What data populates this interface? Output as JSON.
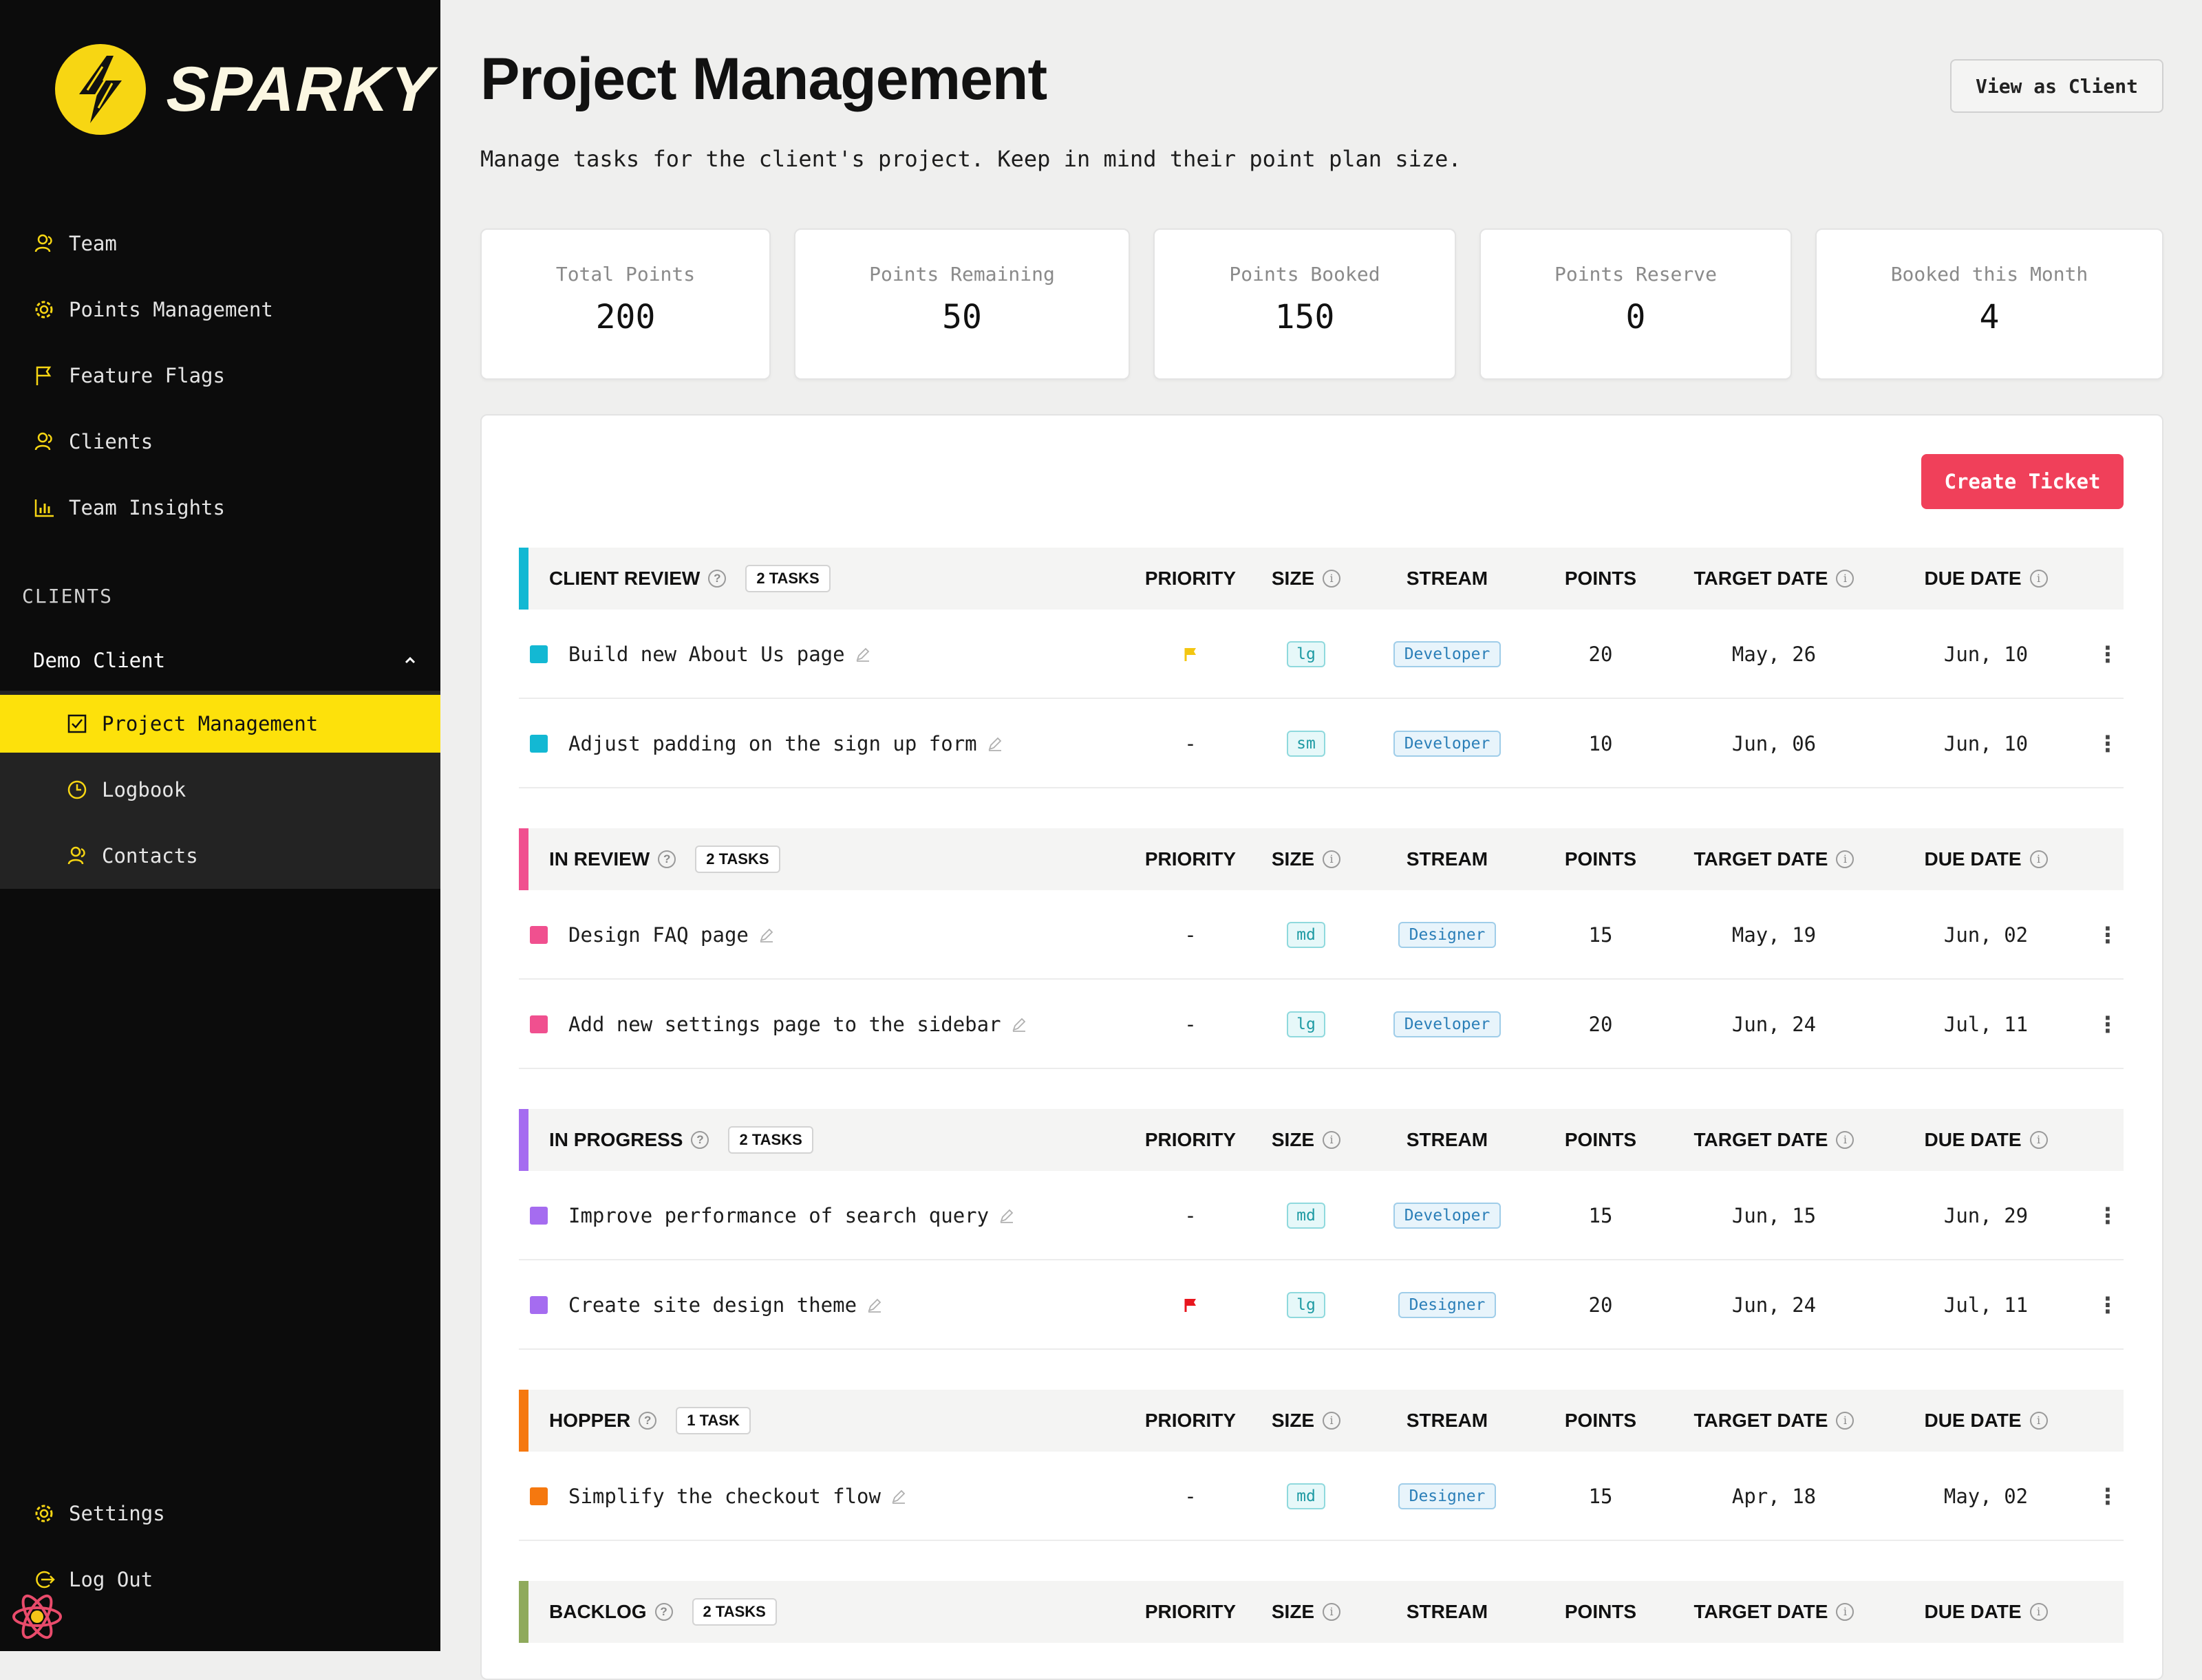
{
  "app": {
    "name": "SPARKY"
  },
  "sidebar": {
    "nav": [
      {
        "label": "Team",
        "icon": "users-icon"
      },
      {
        "label": "Points Management",
        "icon": "gear-icon"
      },
      {
        "label": "Feature Flags",
        "icon": "flag-icon"
      },
      {
        "label": "Clients",
        "icon": "users-icon"
      },
      {
        "label": "Team Insights",
        "icon": "bar-chart-icon"
      }
    ],
    "section_label": "CLIENTS",
    "client_name": "Demo Client",
    "client_subnav": [
      {
        "label": "Project Management",
        "icon": "checkbox-icon",
        "active": true
      },
      {
        "label": "Logbook",
        "icon": "clock-icon"
      },
      {
        "label": "Contacts",
        "icon": "users-icon"
      }
    ],
    "bottom": [
      {
        "label": "Settings",
        "icon": "gear-icon"
      },
      {
        "label": "Log Out",
        "icon": "logout-icon"
      }
    ]
  },
  "header": {
    "title": "Project Management",
    "subtitle": "Manage tasks for the client's project. Keep in mind their point plan size.",
    "view_as_client": "View as Client"
  },
  "stats": [
    {
      "label": "Total Points",
      "value": "200"
    },
    {
      "label": "Points Remaining",
      "value": "50"
    },
    {
      "label": "Points Booked",
      "value": "150"
    },
    {
      "label": "Points Reserve",
      "value": "0"
    },
    {
      "label": "Booked this Month",
      "value": "4"
    }
  ],
  "create_ticket": "Create Ticket",
  "columns": {
    "priority": "PRIORITY",
    "size": "SIZE",
    "stream": "STREAM",
    "points": "POINTS",
    "target": "TARGET DATE",
    "due": "DUE DATE"
  },
  "colors": {
    "accent": "#fde10b",
    "create": "#f0405a",
    "client_review": "#13b8d3",
    "in_review": "#f0508f",
    "in_progress": "#a56cf0",
    "hopper": "#f5780f",
    "backlog": "#8faa5c"
  },
  "groups": [
    {
      "name": "CLIENT REVIEW",
      "count": "2 TASKS",
      "tasks": [
        {
          "title": "Build new About Us page",
          "priority": "flag-yellow",
          "size": "lg",
          "stream": "Developer",
          "points": "20",
          "target": "May, 26",
          "due": "Jun, 10"
        },
        {
          "title": "Adjust padding on the sign up form",
          "priority": "-",
          "size": "sm",
          "stream": "Developer",
          "points": "10",
          "target": "Jun, 06",
          "due": "Jun, 10"
        }
      ]
    },
    {
      "name": "IN REVIEW",
      "count": "2 TASKS",
      "tasks": [
        {
          "title": "Design FAQ page",
          "priority": "-",
          "size": "md",
          "stream": "Designer",
          "points": "15",
          "target": "May, 19",
          "due": "Jun, 02"
        },
        {
          "title": "Add new settings page to the sidebar",
          "priority": "-",
          "size": "lg",
          "stream": "Developer",
          "points": "20",
          "target": "Jun, 24",
          "due": "Jul, 11"
        }
      ]
    },
    {
      "name": "IN PROGRESS",
      "count": "2 TASKS",
      "tasks": [
        {
          "title": "Improve performance of search query",
          "priority": "-",
          "size": "md",
          "stream": "Developer",
          "points": "15",
          "target": "Jun, 15",
          "due": "Jun, 29"
        },
        {
          "title": "Create site design theme",
          "priority": "flag-red",
          "size": "lg",
          "stream": "Designer",
          "points": "20",
          "target": "Jun, 24",
          "due": "Jul, 11"
        }
      ]
    },
    {
      "name": "HOPPER",
      "count": "1 TASK",
      "tasks": [
        {
          "title": "Simplify the checkout flow",
          "priority": "-",
          "size": "md",
          "stream": "Designer",
          "points": "15",
          "target": "Apr, 18",
          "due": "May, 02"
        }
      ]
    },
    {
      "name": "BACKLOG",
      "count": "2 TASKS",
      "tasks": []
    }
  ]
}
